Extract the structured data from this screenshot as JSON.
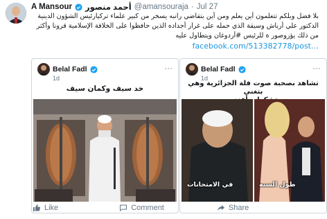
{
  "tweet": {
    "author_name": "A Mansour",
    "author_name_ar": "أحمد منصور",
    "handle": "@amansouraja",
    "date": "Jul 27",
    "lines": [
      "بلا فضل وبلكم تتعلمون أين يعلم ومن أين بتقاضي رانبه يسخر من كبير علماء تركيارئيس الشؤون الدينية",
      "الدكتور علي أرباش وسيقة الذي حمله على غرار أجداده الذين حافظوا على الخلافة الإسلامية قرونا وأكثر",
      "من ذلك يؤزوصور ة للرئيس #أردوغان ويتطاول عليه"
    ],
    "link": "facebook.com/513382778/post…"
  },
  "card_left": {
    "author": "Belal Fadl",
    "time": "1d",
    "caption": "خد سيف وكمان سيف"
  },
  "card_right": {
    "author": "Belal Fadl",
    "time": "1d",
    "caption_lines": [
      "تشاهد بصحبة صوت فلة الجزائرية وهي بتغني",
      "تشكرات أفندم"
    ],
    "label_left": "في الامتحانات",
    "label_right": "طول السنه"
  },
  "actions": {
    "like_label": "Like",
    "comment_label": "Comment",
    "share_label": "Share"
  },
  "colors": {
    "link": "#1b95e0",
    "verified": "#1da1f2",
    "muted": "#657786",
    "border": "#ccd6dd"
  }
}
